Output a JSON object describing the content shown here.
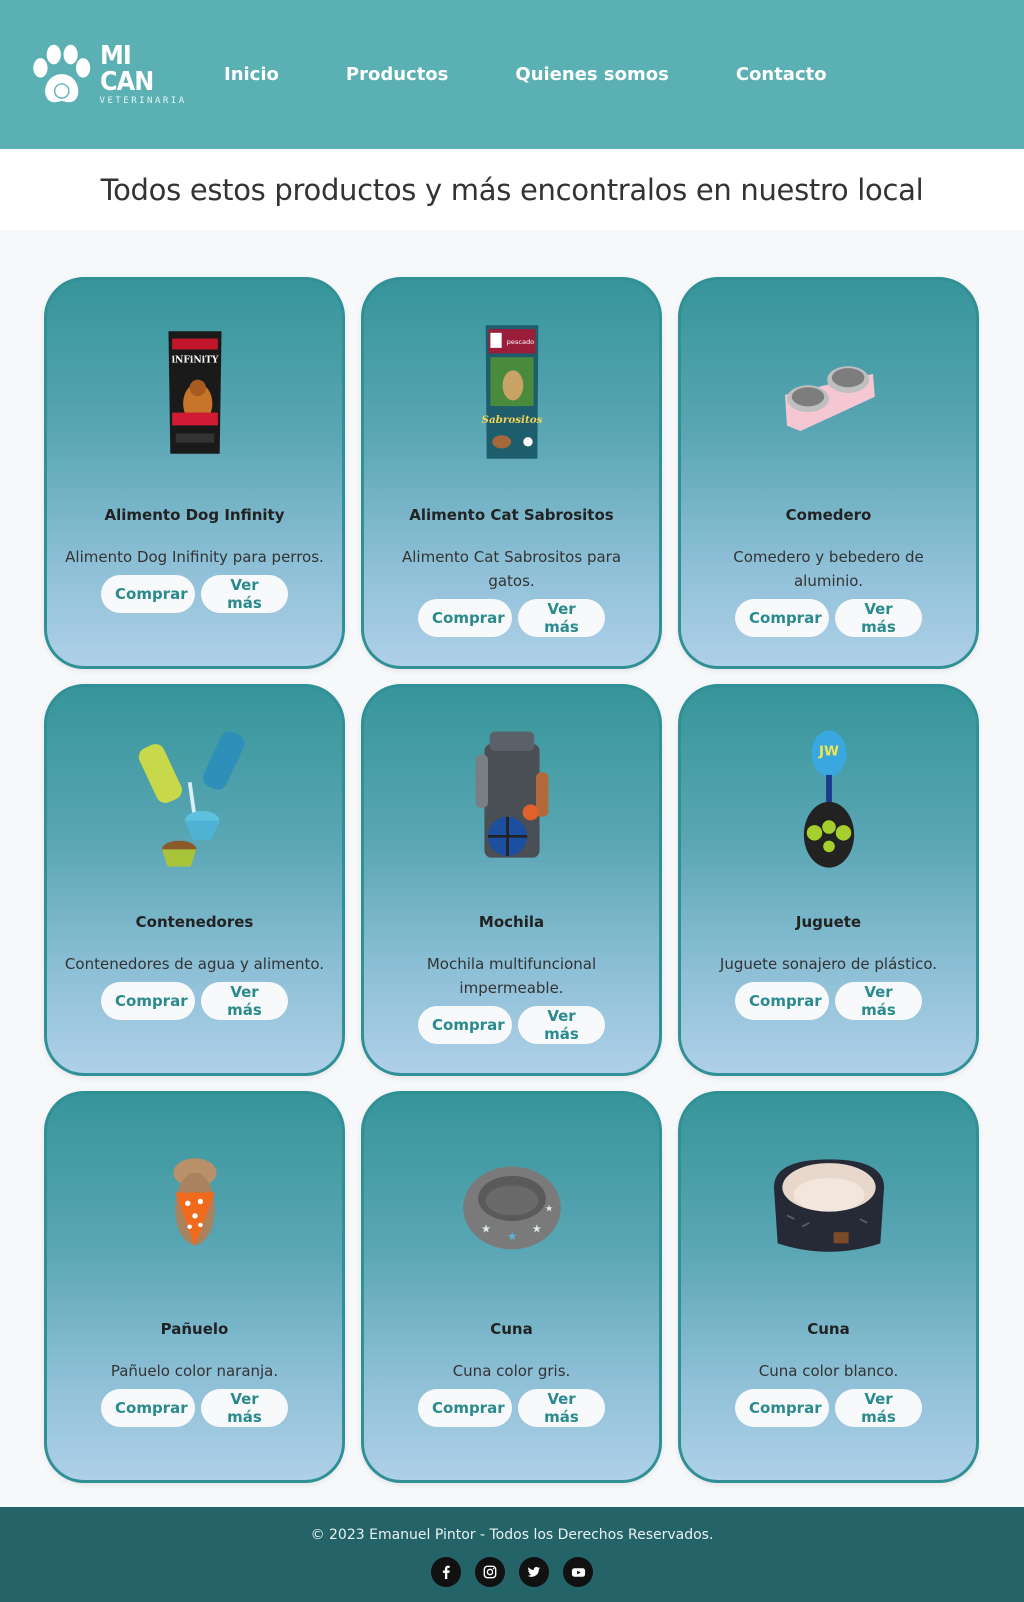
{
  "brand": {
    "name": "MI CAN",
    "tagline": "VETERINARIA"
  },
  "nav": [
    "Inicio",
    "Productos",
    "Quienes somos",
    "Contacto"
  ],
  "heading": "Todos estos productos y más encontralos en nuestro local",
  "buttons": {
    "buy": "Comprar",
    "more": "Ver más"
  },
  "products": [
    {
      "title": "Alimento Dog Infinity",
      "desc": "Alimento Dog Inifinity para perros.",
      "icon": "dog-food-bag-icon"
    },
    {
      "title": "Alimento Cat Sabrositos",
      "desc": "Alimento Cat Sabrositos para gatos.",
      "icon": "cat-food-bag-icon"
    },
    {
      "title": "Comedero",
      "desc": "Comedero y bebedero de aluminio.",
      "icon": "double-bowl-icon"
    },
    {
      "title": "Contenedores",
      "desc": "Contenedores de agua y alimento.",
      "icon": "containers-icon"
    },
    {
      "title": "Mochila",
      "desc": "Mochila multifuncional impermeable.",
      "icon": "backpack-icon"
    },
    {
      "title": "Juguete",
      "desc": "Juguete sonajero de plástico.",
      "icon": "toy-ball-icon"
    },
    {
      "title": "Pañuelo",
      "desc": "Pañuelo color naranja.",
      "icon": "bandana-icon"
    },
    {
      "title": "Cuna",
      "desc": "Cuna color gris.",
      "icon": "gray-bed-icon"
    },
    {
      "title": "Cuna",
      "desc": "Cuna color blanco.",
      "icon": "white-bed-icon"
    }
  ],
  "footer": {
    "copyright": "© 2023 Emanuel Pintor - Todos los Derechos Reservados.",
    "socials": [
      "facebook-icon",
      "instagram-icon",
      "twitter-icon",
      "youtube-icon"
    ]
  },
  "colors": {
    "header": "#5ab0b2",
    "card_border": "#2f9096",
    "footer": "#246469",
    "button_text": "#2a8a8e"
  }
}
